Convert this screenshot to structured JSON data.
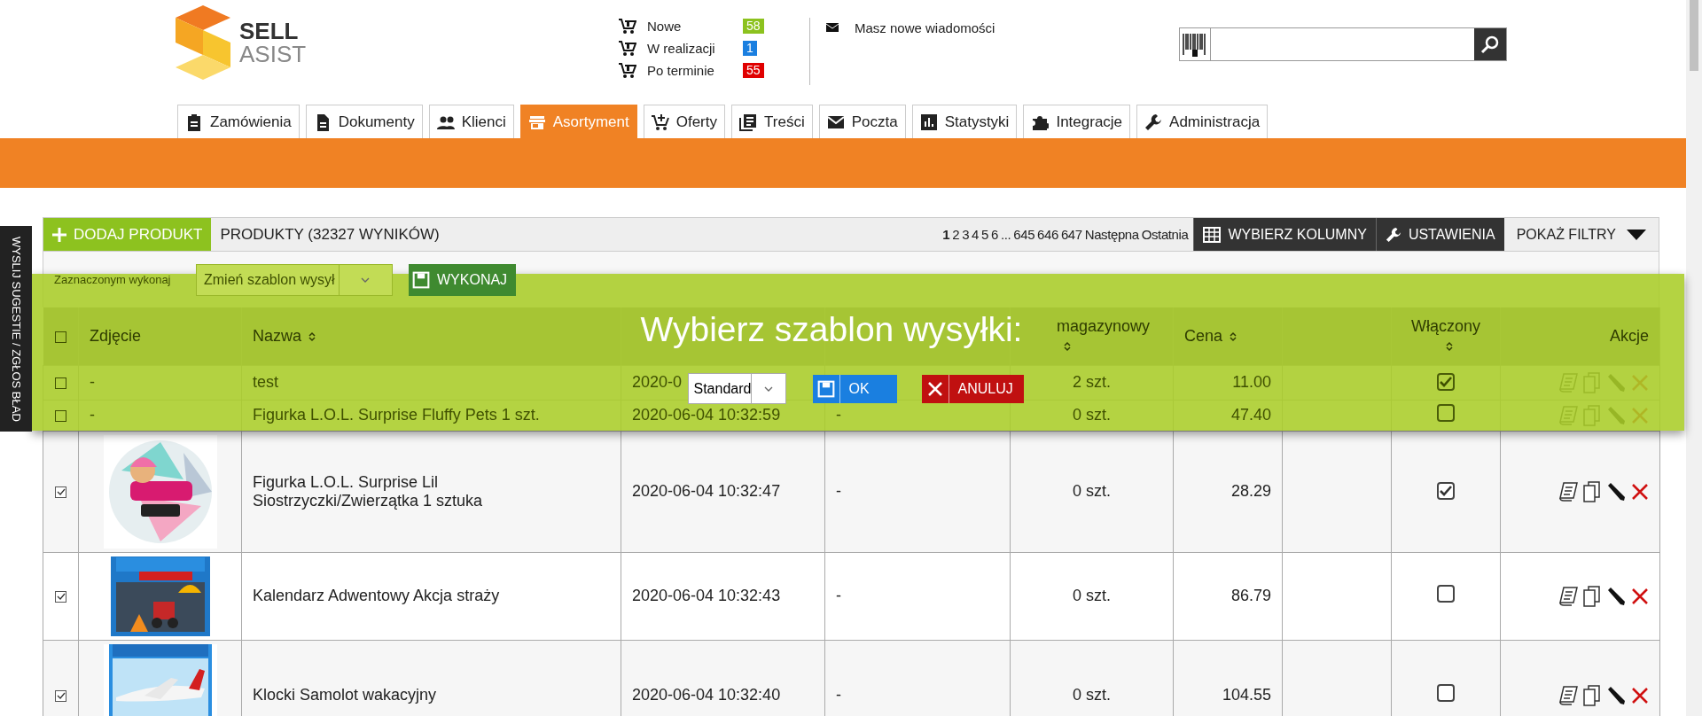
{
  "logo": {
    "line1": "SELL",
    "line2": "ASIST"
  },
  "order_stats": [
    {
      "label": "Nowe",
      "count": "58",
      "color": "#8cc21e"
    },
    {
      "label": "W realizacji",
      "count": "1",
      "color": "#1a7fe0"
    },
    {
      "label": "Po terminie",
      "count": "55",
      "color": "#e00000"
    }
  ],
  "messages": {
    "label": "Masz nowe wiadomości"
  },
  "nav_tabs": [
    {
      "label": "Zamówienia",
      "selected": false
    },
    {
      "label": "Dokumenty",
      "selected": false
    },
    {
      "label": "Klienci",
      "selected": false
    },
    {
      "label": "Asortyment",
      "selected": true
    },
    {
      "label": "Oferty",
      "selected": false
    },
    {
      "label": "Treści",
      "selected": false
    },
    {
      "label": "Poczta",
      "selected": false
    },
    {
      "label": "Statystyki",
      "selected": false
    },
    {
      "label": "Integracje",
      "selected": false
    },
    {
      "label": "Administracja",
      "selected": false
    }
  ],
  "feedback_tab": {
    "label": "WYSLIJ SUGESTIE / ZGŁOS BŁAD"
  },
  "toolbar": {
    "add_button": "DODAJ PRODUKT",
    "title": "PRODUKTY (32327 WYNIKÓW)",
    "pages": [
      {
        "label": "1",
        "selected": true
      },
      {
        "label": "2",
        "selected": false
      },
      {
        "label": "3",
        "selected": false
      },
      {
        "label": "4",
        "selected": false
      },
      {
        "label": "5",
        "selected": false
      },
      {
        "label": "6",
        "selected": false
      },
      {
        "label": "...",
        "selected": false
      },
      {
        "label": "645",
        "selected": false
      },
      {
        "label": "646",
        "selected": false
      },
      {
        "label": "647",
        "selected": false
      }
    ],
    "next": "Następna",
    "last": "Ostatnia",
    "columns_button": "WYBIERZ KOLUMNY",
    "settings_button": "USTAWIENIA",
    "filters_button": "POKAŻ FILTRY"
  },
  "bulk_action": {
    "label": "Zaznaczonym wykonaj",
    "value": "Zmień szablon wysył",
    "button": "WYKONAJ"
  },
  "table": {
    "select_all": {
      "checked": false
    },
    "columns": [
      {
        "label": "Zdjęcie"
      },
      {
        "label": "Nazwa",
        "sortable": true
      },
      {},
      {},
      {
        "label": "magazynowy",
        "sortable": true
      },
      {
        "label": "Cena",
        "sortable": true
      },
      {},
      {
        "label": "Włączony",
        "sortable": true
      },
      {
        "label": "Akcje"
      }
    ],
    "rows": [
      {
        "checked": false,
        "photo": {
          "kind": "text",
          "text": "-"
        },
        "name": "test",
        "date": "2020-0",
        "stock": "2 szt.",
        "price": "11.00",
        "enabled": true
      },
      {
        "checked": false,
        "photo": {
          "kind": "text",
          "text": "-"
        },
        "name": "Figurka L.O.L. Surprise Fluffy Pets 1 szt.",
        "date": "2020-06-04 10:32:59",
        "column_5": "-",
        "stock": "0 szt.",
        "price": "47.40",
        "enabled": false
      },
      {
        "checked": true,
        "name": "Figurka L.O.L. Surprise Lil Siostrzyczki/Zwierzątka 1 sztuka",
        "date": "2020-06-04 10:32:47",
        "column_5": "-",
        "stock": "0 szt.",
        "price": "28.29",
        "enabled": true
      },
      {
        "checked": true,
        "name": "Kalendarz Adwentowy Akcja straży",
        "date": "2020-06-04 10:32:43",
        "column_5": "-",
        "stock": "0 szt.",
        "price": "86.79",
        "enabled": false
      },
      {
        "checked": true,
        "name": "Klocki Samolot wakacyjny",
        "date": "2020-06-04 10:32:40",
        "column_5": "-",
        "stock": "0 szt.",
        "price": "104.55",
        "enabled": false
      }
    ]
  },
  "dialog": {
    "title": "Wybierz szablon wysyłki:",
    "template": "Standard",
    "ok": "OK",
    "cancel": "ANULUJ"
  }
}
